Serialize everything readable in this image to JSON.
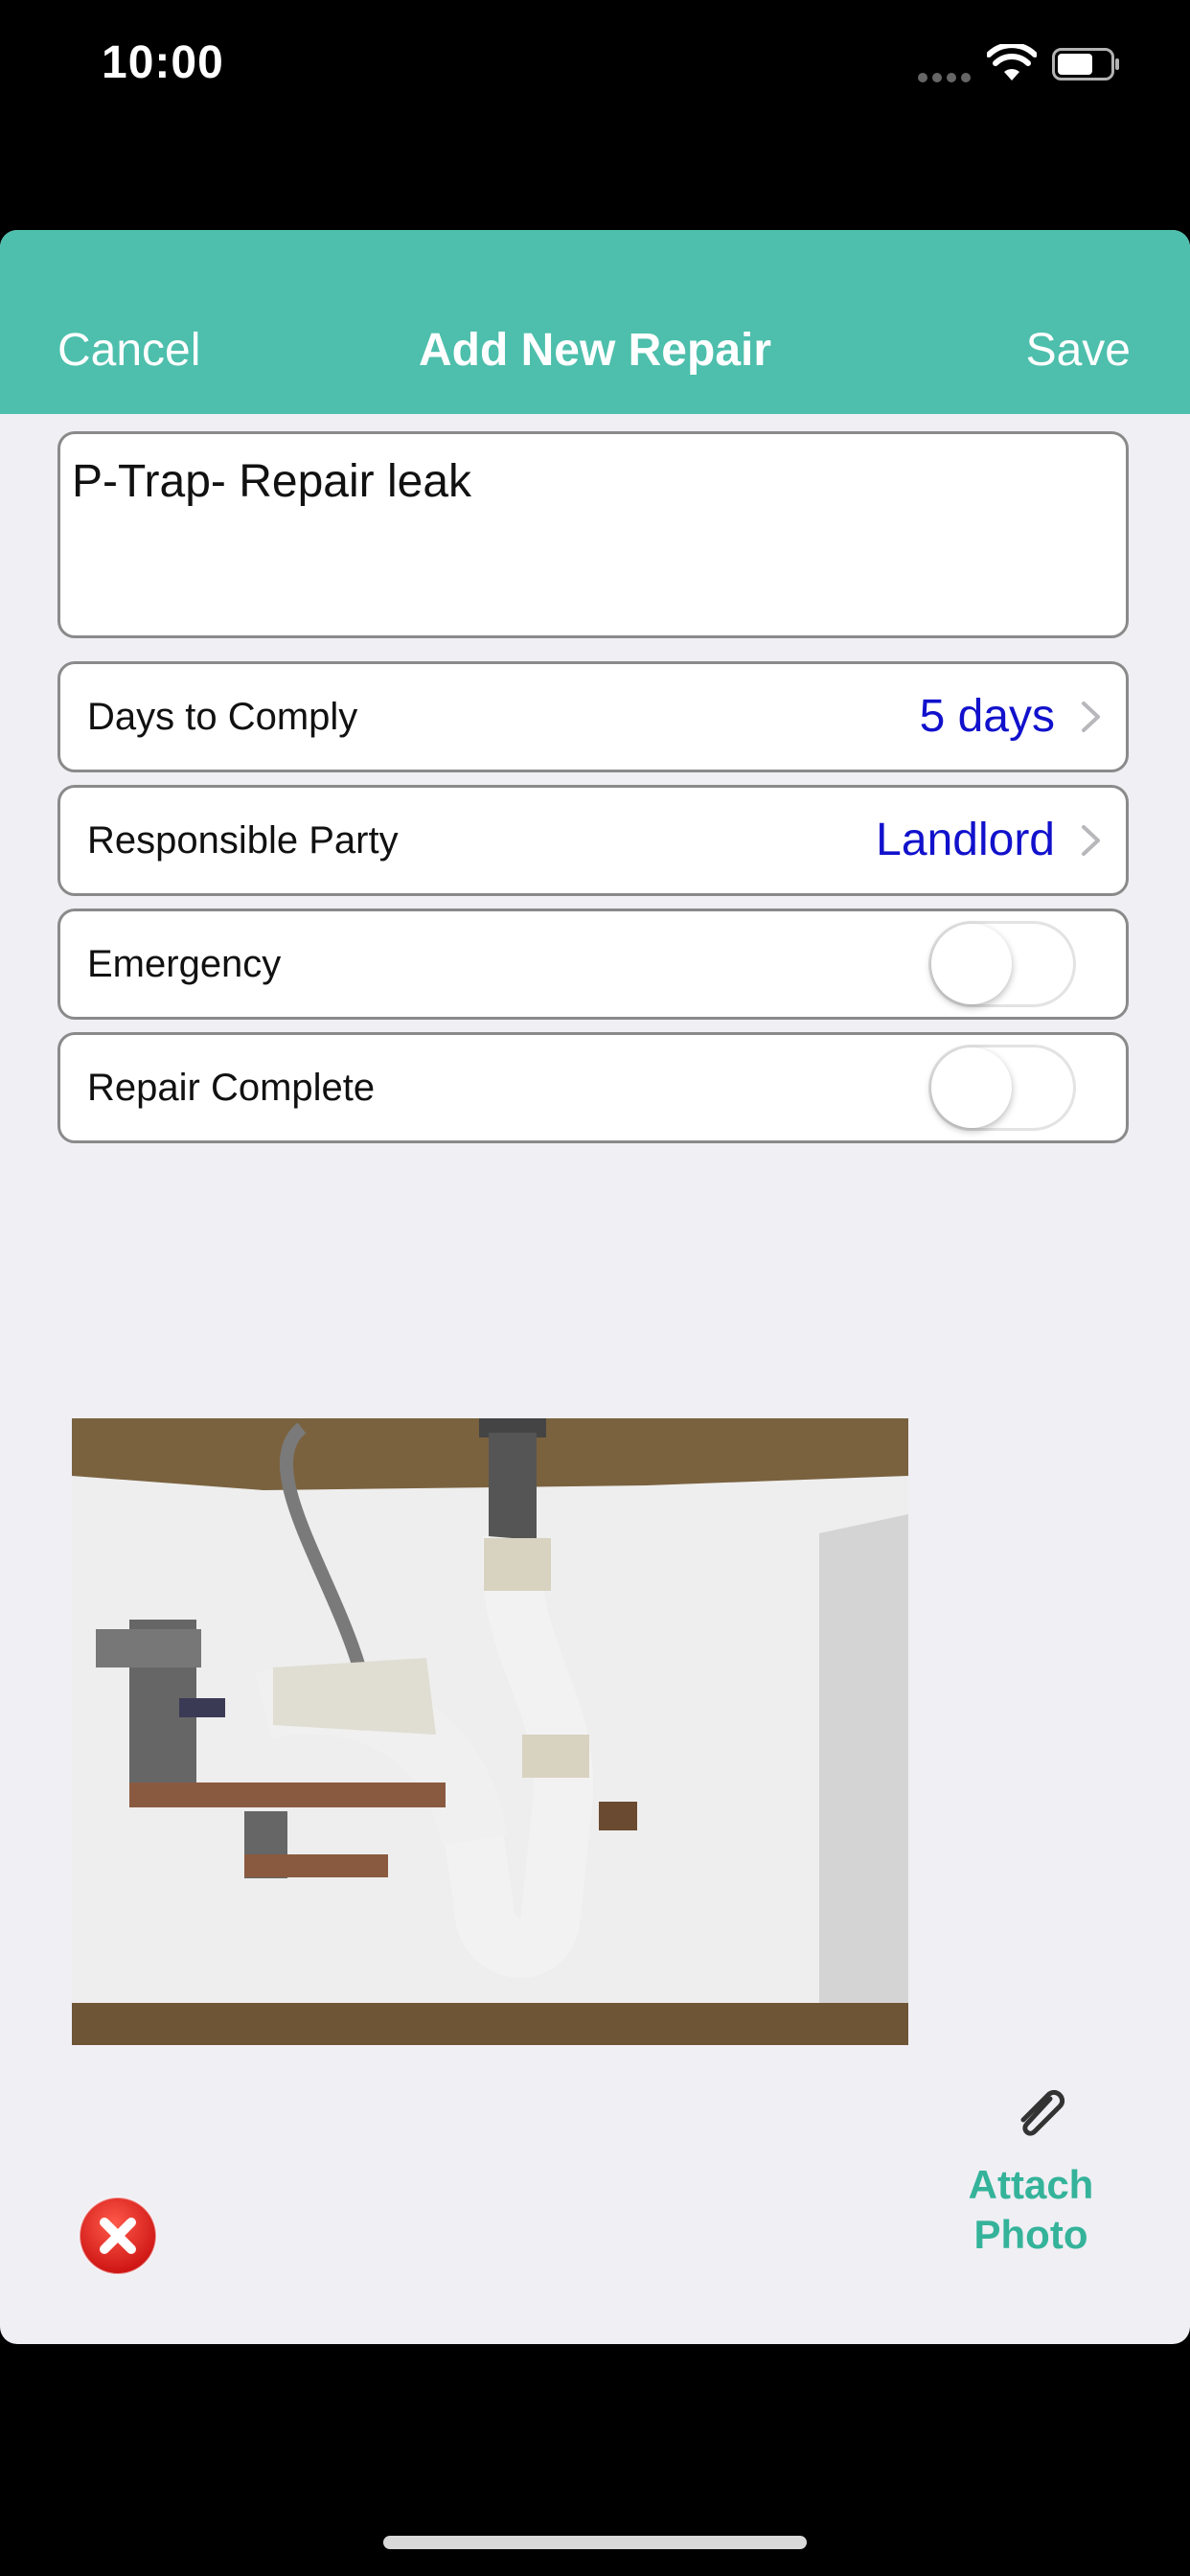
{
  "status_bar": {
    "time": "10:00"
  },
  "nav": {
    "cancel": "Cancel",
    "title": "Add New Repair",
    "save": "Save"
  },
  "description": "P-Trap- Repair leak",
  "rows": [
    {
      "label": "Days to Comply",
      "value": "5 days"
    },
    {
      "label": "Responsible Party",
      "value": "Landlord"
    },
    {
      "label": "Emergency",
      "on": false
    },
    {
      "label": "Repair Complete",
      "on": false
    }
  ],
  "photo": {
    "subject": "plumbing-under-sink"
  },
  "attach": {
    "line1": "Attach",
    "line2": "Photo",
    "icon": "paperclip-icon"
  },
  "delete_icon": "close-icon",
  "colors": {
    "header": "#4dbfac",
    "accent": "#34b39a",
    "value": "#1111cc",
    "background": "#efeff4"
  }
}
